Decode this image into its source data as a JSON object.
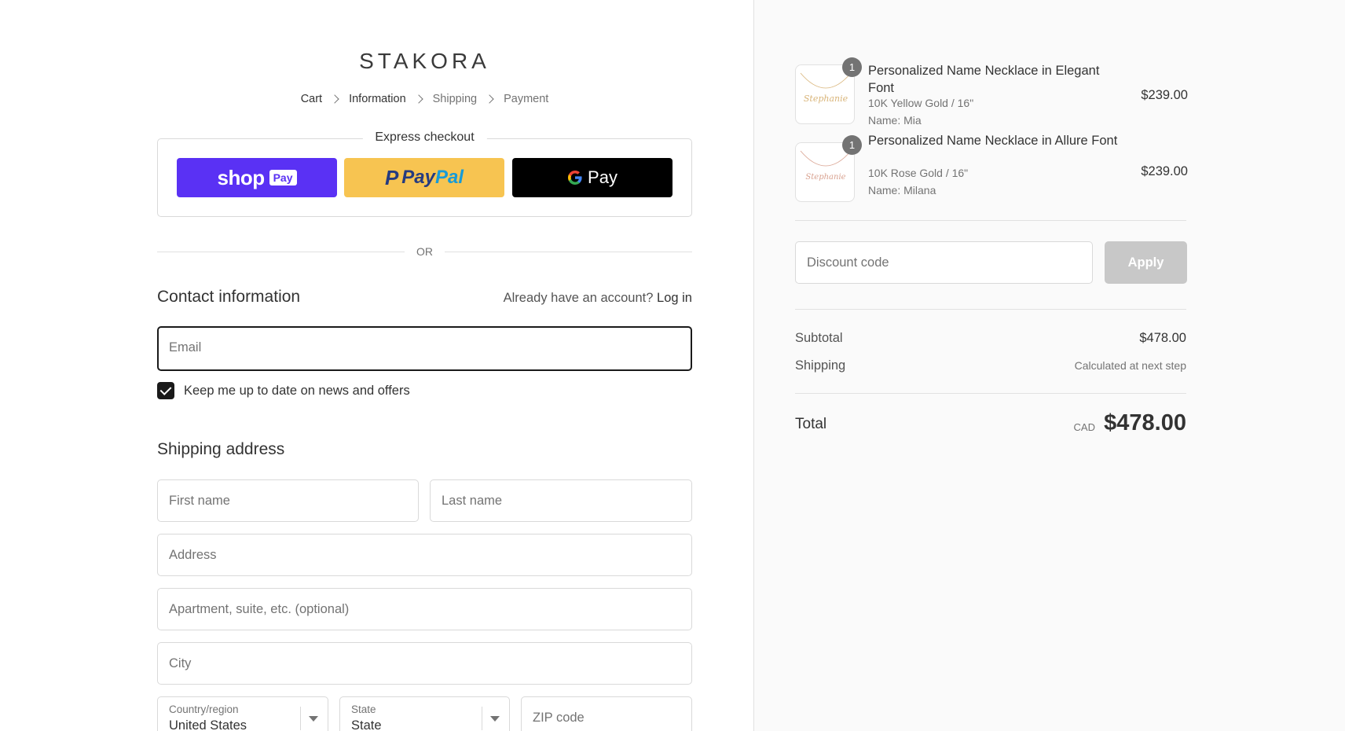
{
  "brand": {
    "name": "STAKORA"
  },
  "breadcrumb": [
    {
      "label": "Cart"
    },
    {
      "label": "Information"
    },
    {
      "label": "Shipping"
    },
    {
      "label": "Payment"
    }
  ],
  "express": {
    "title": "Express checkout",
    "shoppay": {
      "text": "shop",
      "badge": "Pay"
    },
    "paypal": {
      "p": "P",
      "pay": "Pay",
      "pal": "Pal"
    },
    "gpay": {
      "g": "G",
      "text": "Pay"
    }
  },
  "or_label": "OR",
  "contact": {
    "title": "Contact information",
    "account_prompt": "Already have an account?",
    "login": "Log in",
    "email_placeholder": "Email",
    "newsletter_label": "Keep me up to date on news and offers"
  },
  "shipping": {
    "title": "Shipping address",
    "first_name": "First name",
    "last_name": "Last name",
    "address": "Address",
    "apartment": "Apartment, suite, etc. (optional)",
    "city": "City",
    "country_label": "Country/region",
    "country_value": "United States",
    "state_label": "State",
    "state_value": "State",
    "zip": "ZIP code"
  },
  "cart": {
    "items": [
      {
        "name": "Personalized Name Necklace in Elegant Font",
        "variant": "10K Yellow Gold / 16\"",
        "personalization": "Name: Mia",
        "qty": "1",
        "price": "$239.00",
        "metal_color": "#d9b57a"
      },
      {
        "name": "Personalized Name Necklace in Allure Font",
        "variant": "10K Rose Gold / 16\"",
        "personalization": "Name: Milana",
        "qty": "1",
        "price": "$239.00",
        "metal_color": "#d9a290"
      }
    ],
    "discount_placeholder": "Discount code",
    "apply_label": "Apply",
    "subtotal_label": "Subtotal",
    "subtotal_value": "$478.00",
    "shipping_label": "Shipping",
    "shipping_value": "Calculated at next step",
    "total_label": "Total",
    "currency": "CAD",
    "total_value": "$478.00"
  }
}
